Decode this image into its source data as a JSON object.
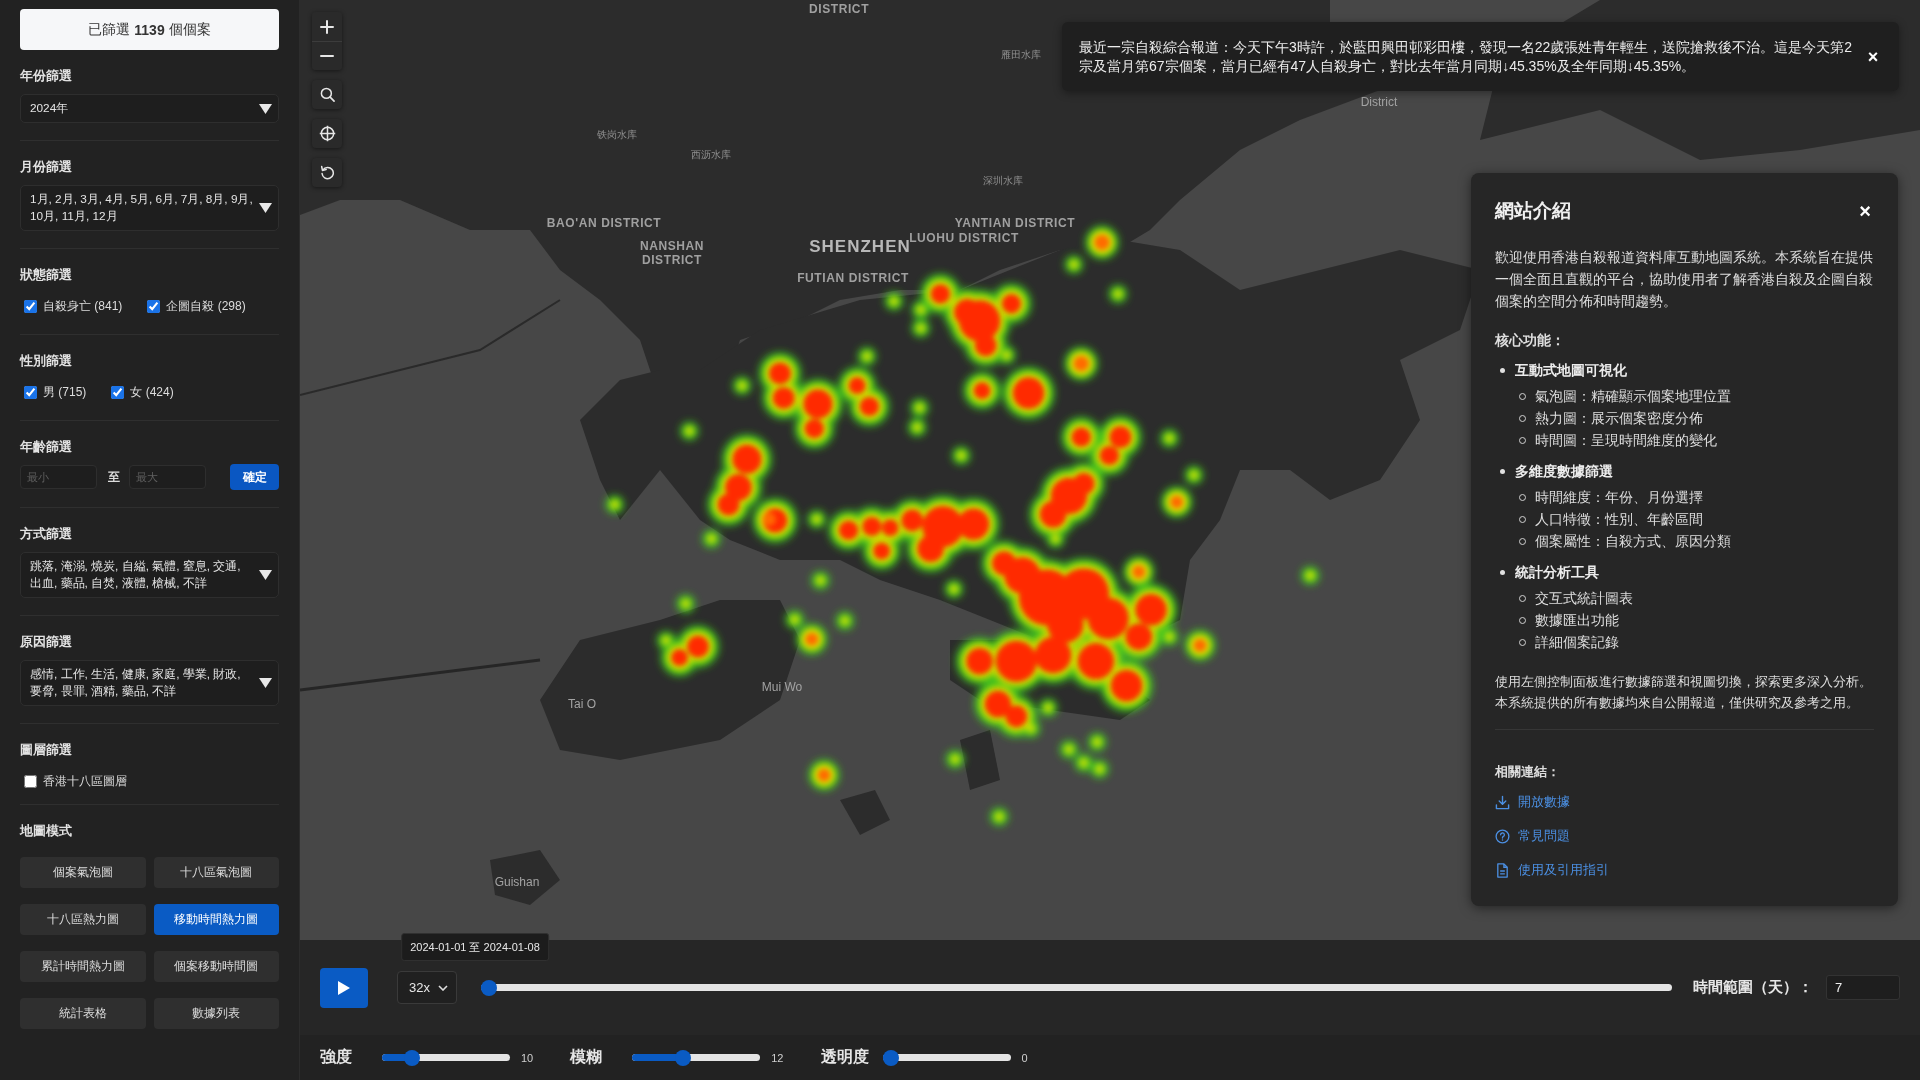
{
  "sidebar": {
    "case_count": "已篩選 **1139** 個個案",
    "filters": [
      {
        "kind": "select",
        "title": "年份篩選",
        "value": "2024年"
      },
      {
        "kind": "select",
        "title": "月份篩選",
        "value": "1月, 2月, 3月, 4月, 5月, 6月, 7月, 8月, 9月, 10月, 11月, 12月"
      },
      {
        "kind": "checkboxes",
        "title": "狀態篩選",
        "options": [
          {
            "label": "自殺身亡 (841)",
            "checked": true
          },
          {
            "label": "企圖自殺 (298)",
            "checked": true
          }
        ]
      },
      {
        "kind": "checkboxes",
        "title": "性別篩選",
        "options": [
          {
            "label": "男 (715)",
            "checked": true
          },
          {
            "label": "女 (424)",
            "checked": true
          }
        ]
      },
      {
        "kind": "range",
        "title": "年齡篩選",
        "fields": [
          {
            "placeholder": "最小"
          },
          {
            "placeholder": "最大"
          }
        ],
        "separator": "至",
        "button": "確定"
      },
      {
        "kind": "select",
        "title": "方式篩選",
        "value": "跳落, 淹溺, 燒炭, 自縊, 氣體, 窒息, 交通, 出血, 藥品, 自焚, 液體, 槍械, 不詳"
      },
      {
        "kind": "select",
        "title": "原因篩選",
        "value": "感情, 工作, 生活, 健康, 家庭, 學業, 財政, 要脅, 畏罪, 酒精, 藥品, 不詳"
      },
      {
        "kind": "checkboxes",
        "title": "圖層篩選",
        "options": [
          {
            "label": "香港十八區圖層",
            "checked": false
          }
        ]
      }
    ],
    "map_mode": {
      "title": "地圖模式",
      "buttons": [
        {
          "label": "個案氣泡圖",
          "selected": false
        },
        {
          "label": "十八區氣泡圖",
          "selected": false
        },
        {
          "label": "十八區熱力圖",
          "selected": false
        },
        {
          "label": "移動時間熱力圖",
          "selected": true
        },
        {
          "label": "累計時間熱力圖",
          "selected": false
        },
        {
          "label": "個案移動時間圖",
          "selected": false
        },
        {
          "label": "統計表格",
          "selected": false
        },
        {
          "label": "數據列表",
          "selected": false
        }
      ]
    }
  },
  "map": {
    "labels": [
      "DISTRICT",
      "雁田水库",
      "District",
      "铁岗水库",
      "西沥水库",
      "深圳水库",
      "BAO'AN DISTRICT",
      "YANTIAN DISTRICT",
      "NANSHAN DISTRICT",
      "SHENZHEN",
      "LUOHU DISTRICT",
      "FUTIAN DISTRICT",
      "Mui Wo",
      "Tai O",
      "Guishan"
    ]
  },
  "notification": {
    "text": "最近一宗自殺綜合報道：今天下午3時許，於藍田興田邨彩田樓，發現一名22歲張姓青年輕生，送院搶救後不治。這是今天第2宗及當月第67宗個案，當月已經有47人自殺身亡，對比去年當月同期↓45.35%及全年同期↓45.35%。",
    "close": "×"
  },
  "info_panel": {
    "title": "網站介紹",
    "close": "×",
    "intro": "歡迎使用香港自殺報道資料庫互動地圖系統。本系統旨在提供一個全面且直觀的平台，協助使用者了解香港自殺及企圖自殺個案的空間分佈和時間趨勢。",
    "features_title": "核心功能：",
    "features": [
      {
        "label": "互動式地圖可視化",
        "children": [
          "氣泡圖：精確顯示個案地理位置",
          "熱力圖：展示個案密度分佈",
          "時間圖：呈現時間維度的變化"
        ]
      },
      {
        "label": "多維度數據篩選",
        "children": [
          "時間維度：年份、月份選擇",
          "人口特徵：性別、年齡區間",
          "個案屬性：自殺方式、原因分類"
        ]
      },
      {
        "label": "統計分析工具",
        "children": [
          "交互式統計圖表",
          "數據匯出功能",
          "詳細個案記錄"
        ]
      }
    ],
    "footer": [
      "使用左側控制面板進行數據篩選和視圖切換，探索更多深入分析。",
      "本系統提供的所有數據均來自公開報道，僅供研究及參考之用。"
    ],
    "links_title": "相關連結：",
    "links": [
      "開放數據",
      "常見問題",
      "使用及引用指引"
    ]
  },
  "timeline": {
    "range": "2024-01-01 至 2024-01-08",
    "speed": "32x",
    "level": 0,
    "days_label": "時間範圍（天）：",
    "days_value": "7"
  },
  "heat_controls": [
    {
      "label": "強度",
      "level": 0.2,
      "reading": "10"
    },
    {
      "label": "模糊",
      "level": 0.38,
      "reading": "12"
    },
    {
      "label": "透明度",
      "level": 0,
      "reading": "0"
    }
  ]
}
